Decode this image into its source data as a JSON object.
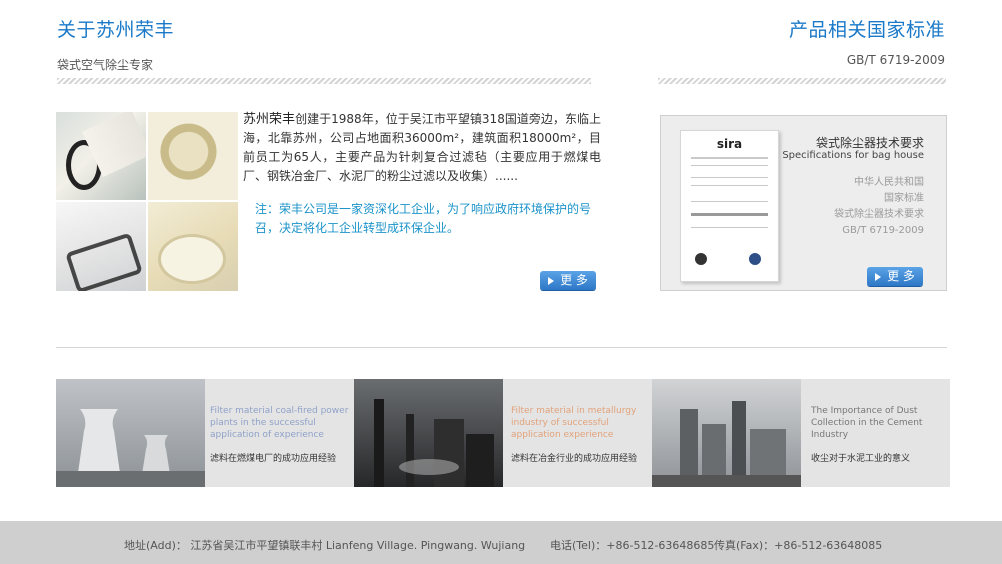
{
  "about": {
    "title": "关于苏州荣丰",
    "subtitle": "袋式空气除尘专家",
    "brand": "苏州荣丰",
    "body": "创建于1988年，位于吴江市平望镇318国道旁边，东临上海，北靠苏州，公司占地面积36000m²，建筑面积18000m²，目前员工为65人，主要产品为针刺复合过滤毡（主要应用于燃煤电厂、钢铁冶金厂、水泥厂的粉尘过滤以及收集）......",
    "note": "注：荣丰公司是一家资深化工企业，为了响应政府环境保护的号召，决定将化工企业转型成环保企业。",
    "more_label": "更 多"
  },
  "standard": {
    "title": "产品相关国家标准",
    "code": "GB/T 6719-2009",
    "box_title": "袋式除尘器技术要求",
    "box_title_en": "Specifications for bag house",
    "lines": [
      "中华人民共和国",
      "国家标准",
      "袋式除尘器技术要求",
      "GB/T 6719-2009"
    ],
    "cert_logo": "sira",
    "more_label": "更 多"
  },
  "cases": [
    {
      "en": "Filter material coal-fired power plants in the successful application of experience",
      "cn": "滤料在燃煤电厂的成功应用经验",
      "en_color": "#8fa2c9"
    },
    {
      "en": "Filter material in metallurgy industry of successful application experience",
      "cn": "滤料在冶金行业的成功应用经验",
      "en_color": "#e2a27a"
    },
    {
      "en": "The Importance of Dust Collection in the Cement Industry",
      "cn": "收尘对于水泥工业的意义",
      "en_color": "#777777"
    }
  ],
  "footer": {
    "address": "地址(Add)： 江苏省吴江市平望镇联丰村 Lianfeng Village. Pingwang. Wujiang",
    "tel": "电话(Tel)：+86-512-63648685",
    "fax": "传真(Fax)：+86-512-63648085"
  },
  "colors": {
    "accent_blue": "#1a79c8",
    "note_cyan": "#1b93c9",
    "button_blue": "#2d77c7"
  }
}
